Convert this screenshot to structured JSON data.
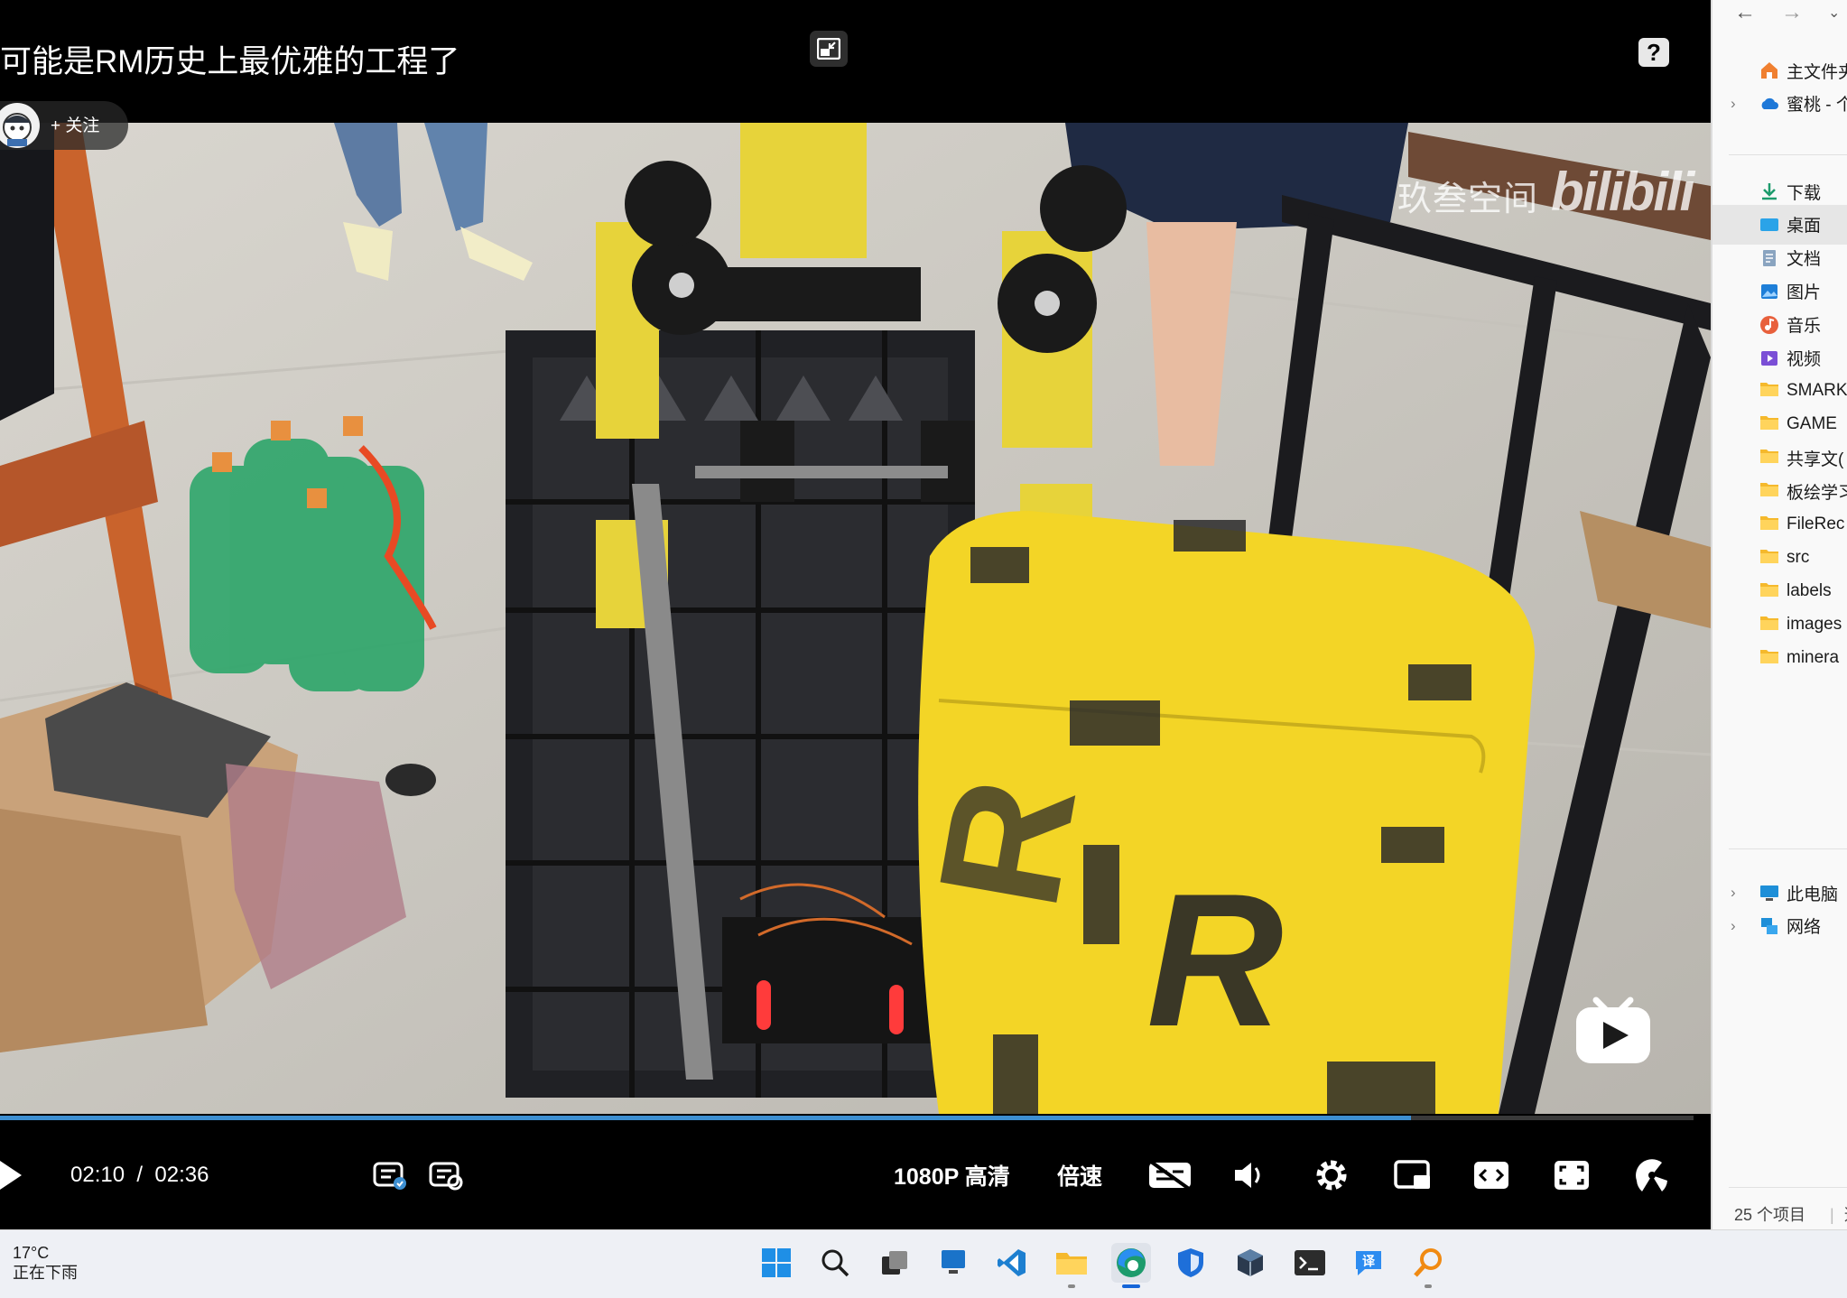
{
  "player": {
    "title": "可能是RM历史上最优雅的工程了",
    "follow_label": "+ 关注",
    "watermark_text": "玖叁空间",
    "watermark_logo": "bilibili",
    "current_time": "02:10",
    "time_separator": "/",
    "duration": "02:36",
    "progress": 0.833,
    "quality_label": "1080P 高清",
    "speed_label": "倍速",
    "help_glyph": "?",
    "accent_color": "#3d8fd1"
  },
  "explorer": {
    "nav_back": "←",
    "nav_forward": "→",
    "quick": [
      {
        "label": "主文件夹",
        "icon": "home-icon"
      },
      {
        "label": "蜜桃 - 个人",
        "icon": "cloud-icon"
      }
    ],
    "pinned": [
      {
        "label": "下载",
        "icon": "download-icon"
      },
      {
        "label": "桌面",
        "icon": "desktop-icon"
      },
      {
        "label": "文档",
        "icon": "document-icon"
      },
      {
        "label": "图片",
        "icon": "pictures-icon"
      },
      {
        "label": "音乐",
        "icon": "music-icon"
      },
      {
        "label": "视频",
        "icon": "video-icon"
      },
      {
        "label": "SMARK",
        "icon": "folder-icon"
      },
      {
        "label": "GAME",
        "icon": "folder-icon"
      },
      {
        "label": "共享文(",
        "icon": "folder-icon"
      },
      {
        "label": "板绘学习",
        "icon": "folder-icon"
      },
      {
        "label": "FileRec",
        "icon": "folder-icon"
      },
      {
        "label": "src",
        "icon": "folder-icon"
      },
      {
        "label": "labels",
        "icon": "folder-icon"
      },
      {
        "label": "images",
        "icon": "folder-icon"
      },
      {
        "label": "minera",
        "icon": "folder-icon"
      }
    ],
    "bottom": [
      {
        "label": "此电脑",
        "icon": "pc-icon"
      },
      {
        "label": "网络",
        "icon": "network-icon"
      }
    ],
    "status_count": "25 个项目",
    "status_extra": "选"
  },
  "taskbar": {
    "temperature": "17°C",
    "condition": "正在下雨"
  }
}
